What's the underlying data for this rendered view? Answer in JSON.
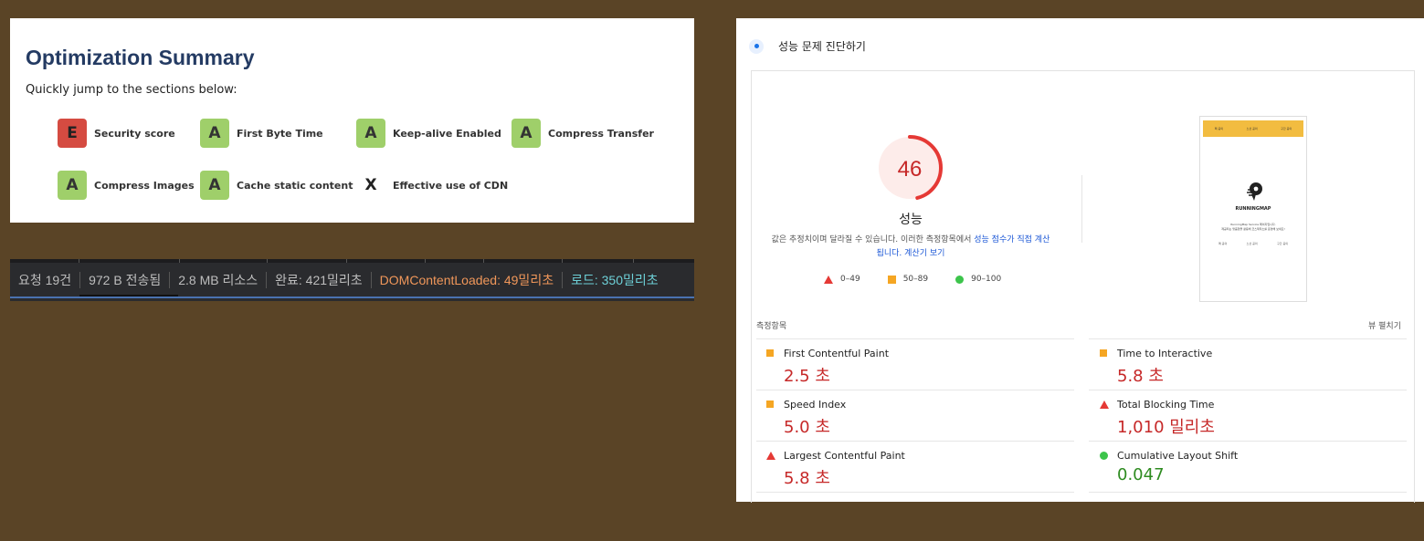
{
  "optimization": {
    "title": "Optimization Summary",
    "subtitle": "Quickly jump to the sections below:",
    "items": [
      {
        "grade": "E",
        "label": "Security score"
      },
      {
        "grade": "A",
        "label": "First Byte Time"
      },
      {
        "grade": "A",
        "label": "Keep-alive Enabled"
      },
      {
        "grade": "A",
        "label": "Compress Transfer"
      },
      {
        "grade": "A",
        "label": "Compress Images"
      },
      {
        "grade": "A",
        "label": "Cache static content"
      },
      {
        "grade": "X",
        "label": "Effective use of CDN"
      }
    ],
    "colors": {
      "fail": "#d54b41",
      "pass": "#9fcf6a",
      "title": "#243b63"
    }
  },
  "devtools": {
    "requests": "요청 19건",
    "transferred": "972 B 전송됨",
    "resources": "2.8 MB 리소스",
    "finish": "완료: 421밀리초",
    "dom_content_loaded": "DOMContentLoaded: 49밀리초",
    "load": "로드: 350밀리초"
  },
  "lighthouse": {
    "header": "성능 문제 진단하기",
    "score": "46",
    "score_fraction": 0.46,
    "score_label": "성능",
    "note_prefix": "값은 추정치이며 달라질 수 있습니다. 이러한 측정항목에서 ",
    "note_link1": "성능 점수가 직접 계산됩니다.",
    "note_link2": "계산기 보기",
    "legend": [
      {
        "shape": "triangle",
        "range": "0–49"
      },
      {
        "shape": "square",
        "range": "50–89"
      },
      {
        "shape": "circle",
        "range": "90–100"
      }
    ],
    "thumbnail": {
      "nav": [
        "팩 공의",
        "노선 공의",
        "구간 공의"
      ],
      "brand": "RUNNINGMAP",
      "text1": "RunningMap Service 페이지입니다.",
      "text2": "제공되는 맞춤형을 활용해 코스제작소를 운영해 보세요!",
      "links": [
        "팩 공의",
        "노선 공의",
        "구간 공의"
      ]
    },
    "metrics_header": "측정항목",
    "expand_label": "뷰 펼치기",
    "metrics": [
      {
        "name": "First Contentful Paint",
        "value": "2.5 초",
        "icon": "square",
        "status": "average"
      },
      {
        "name": "Time to Interactive",
        "value": "5.8 초",
        "icon": "square",
        "status": "average"
      },
      {
        "name": "Speed Index",
        "value": "5.0 초",
        "icon": "square",
        "status": "average"
      },
      {
        "name": "Total Blocking Time",
        "value": "1,010 밀리초",
        "icon": "triangle",
        "status": "fail"
      },
      {
        "name": "Largest Contentful Paint",
        "value": "5.8 초",
        "icon": "triangle",
        "status": "fail"
      },
      {
        "name": "Cumulative Layout Shift",
        "value": "0.047",
        "icon": "circle",
        "status": "pass"
      }
    ]
  }
}
